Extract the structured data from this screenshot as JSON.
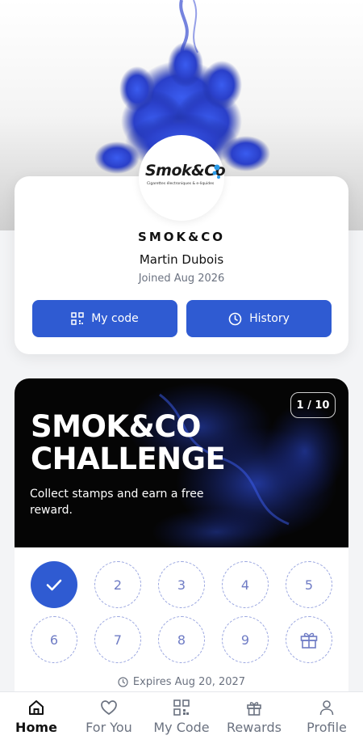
{
  "profile": {
    "brand": "SMOK&CO",
    "logo_text": "Smok&Co",
    "logo_subtext": "Cigarettes électroniques & e-liquides",
    "user_name": "Martin Dubois",
    "joined": "Joined Aug 2026",
    "buttons": {
      "my_code": "My code",
      "history": "History"
    }
  },
  "challenge": {
    "counter": "1 / 10",
    "title": "SMOK&CO CHALLENGE",
    "subtitle": "Collect stamps and earn a free reward.",
    "stamps": [
      {
        "label": "1",
        "done": true
      },
      {
        "label": "2",
        "done": false
      },
      {
        "label": "3",
        "done": false
      },
      {
        "label": "4",
        "done": false
      },
      {
        "label": "5",
        "done": false
      },
      {
        "label": "6",
        "done": false
      },
      {
        "label": "7",
        "done": false
      },
      {
        "label": "8",
        "done": false
      },
      {
        "label": "9",
        "done": false
      },
      {
        "label": "reward",
        "done": false
      }
    ],
    "expires": "Expires Aug 20, 2027"
  },
  "nav": {
    "items": [
      {
        "label": "Home",
        "icon": "home-icon",
        "active": true
      },
      {
        "label": "For You",
        "icon": "heart-icon",
        "active": false
      },
      {
        "label": "My Code",
        "icon": "qr-code-icon",
        "active": false
      },
      {
        "label": "Rewards",
        "icon": "gift-icon",
        "active": false
      },
      {
        "label": "Profile",
        "icon": "user-icon",
        "active": false
      }
    ]
  },
  "colors": {
    "accent": "#2f5bd2",
    "stamp_border": "#9aa6e0",
    "banner_bg": "#050505"
  }
}
